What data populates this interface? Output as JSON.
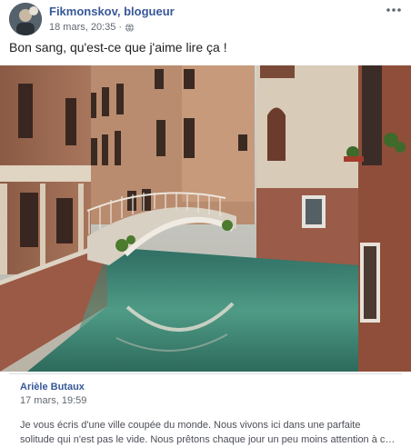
{
  "post": {
    "author": "Fikmonskov, blogueur",
    "date": "18 mars, 20:35",
    "separator": "·",
    "privacy_icon": "globe-icon",
    "options_icon": "more-options-icon",
    "text": "Bon sang, qu'est-ce que j'aime lire ça !"
  },
  "shared": {
    "author": "Arièle Butaux",
    "date": "17 mars, 19:59",
    "excerpt": "Je vous écris d'une ville coupée du monde. Nous vivons ici dans une parfaite solitude qui n'est pas le vide. Nous prêtons chaque jour un peu moins attention à c…"
  },
  "colors": {
    "link_blue": "#385898",
    "meta_gray": "#616770",
    "canal_green": "#3f8a78"
  }
}
